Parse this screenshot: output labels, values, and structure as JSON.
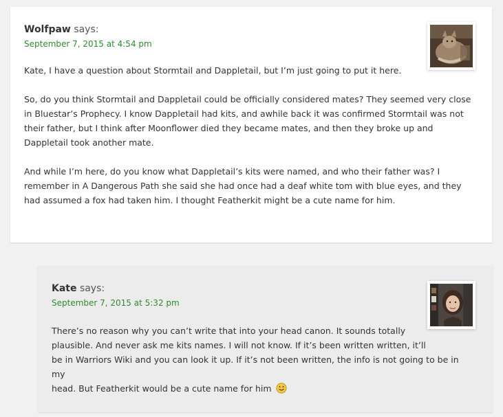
{
  "comments": [
    {
      "author": "Wolfpaw",
      "says": "says:",
      "date": "September 7, 2015 at 4:54 pm",
      "paragraphs": [
        "Kate, I have a question about Stormtail and Dappletail, but I’m just going to put it here.",
        "So, do you think Stormtail and Dappletail could be officially considered mates? They seemed very close in Bluestar’s Prophecy. I know Dappletail had kits, and awhile back it was confirmed Stormtail was not their father, but I think after Moonflower died they became mates, and then they broke up and Dappletail took another mate.",
        "And while I’m here, do you know what Dappletail’s kits were named, and who their father was? I remember in A Dangerous Path she said she had once had a deaf white tom with blue eyes, and they had assumed a fox had taken him. I thought Featherkit might be a cute name for him."
      ],
      "avatar": "cat-photo-avatar"
    },
    {
      "author": "Kate",
      "says": "says:",
      "date": "September 7, 2015 at 5:32 pm",
      "lines": [
        "There’s no reason why you can’t write that into your head canon. It sounds totally",
        "plausible. And never ask me kits names. I will not know. If it’s been written written, it’ll",
        "be in Warriors Wiki and you can look it up. If it’s not been written, the info is not going to be in my",
        "head. But Featherkit would be a cute name for him"
      ],
      "avatar": "woman-photo-avatar",
      "emoji": "smiley-face-icon"
    }
  ],
  "colors": {
    "page_bg": "#f1f1f1",
    "card_bg": "#ffffff",
    "reply_bg": "#ececec",
    "date_link": "#2f8a2f",
    "text": "#333333"
  }
}
